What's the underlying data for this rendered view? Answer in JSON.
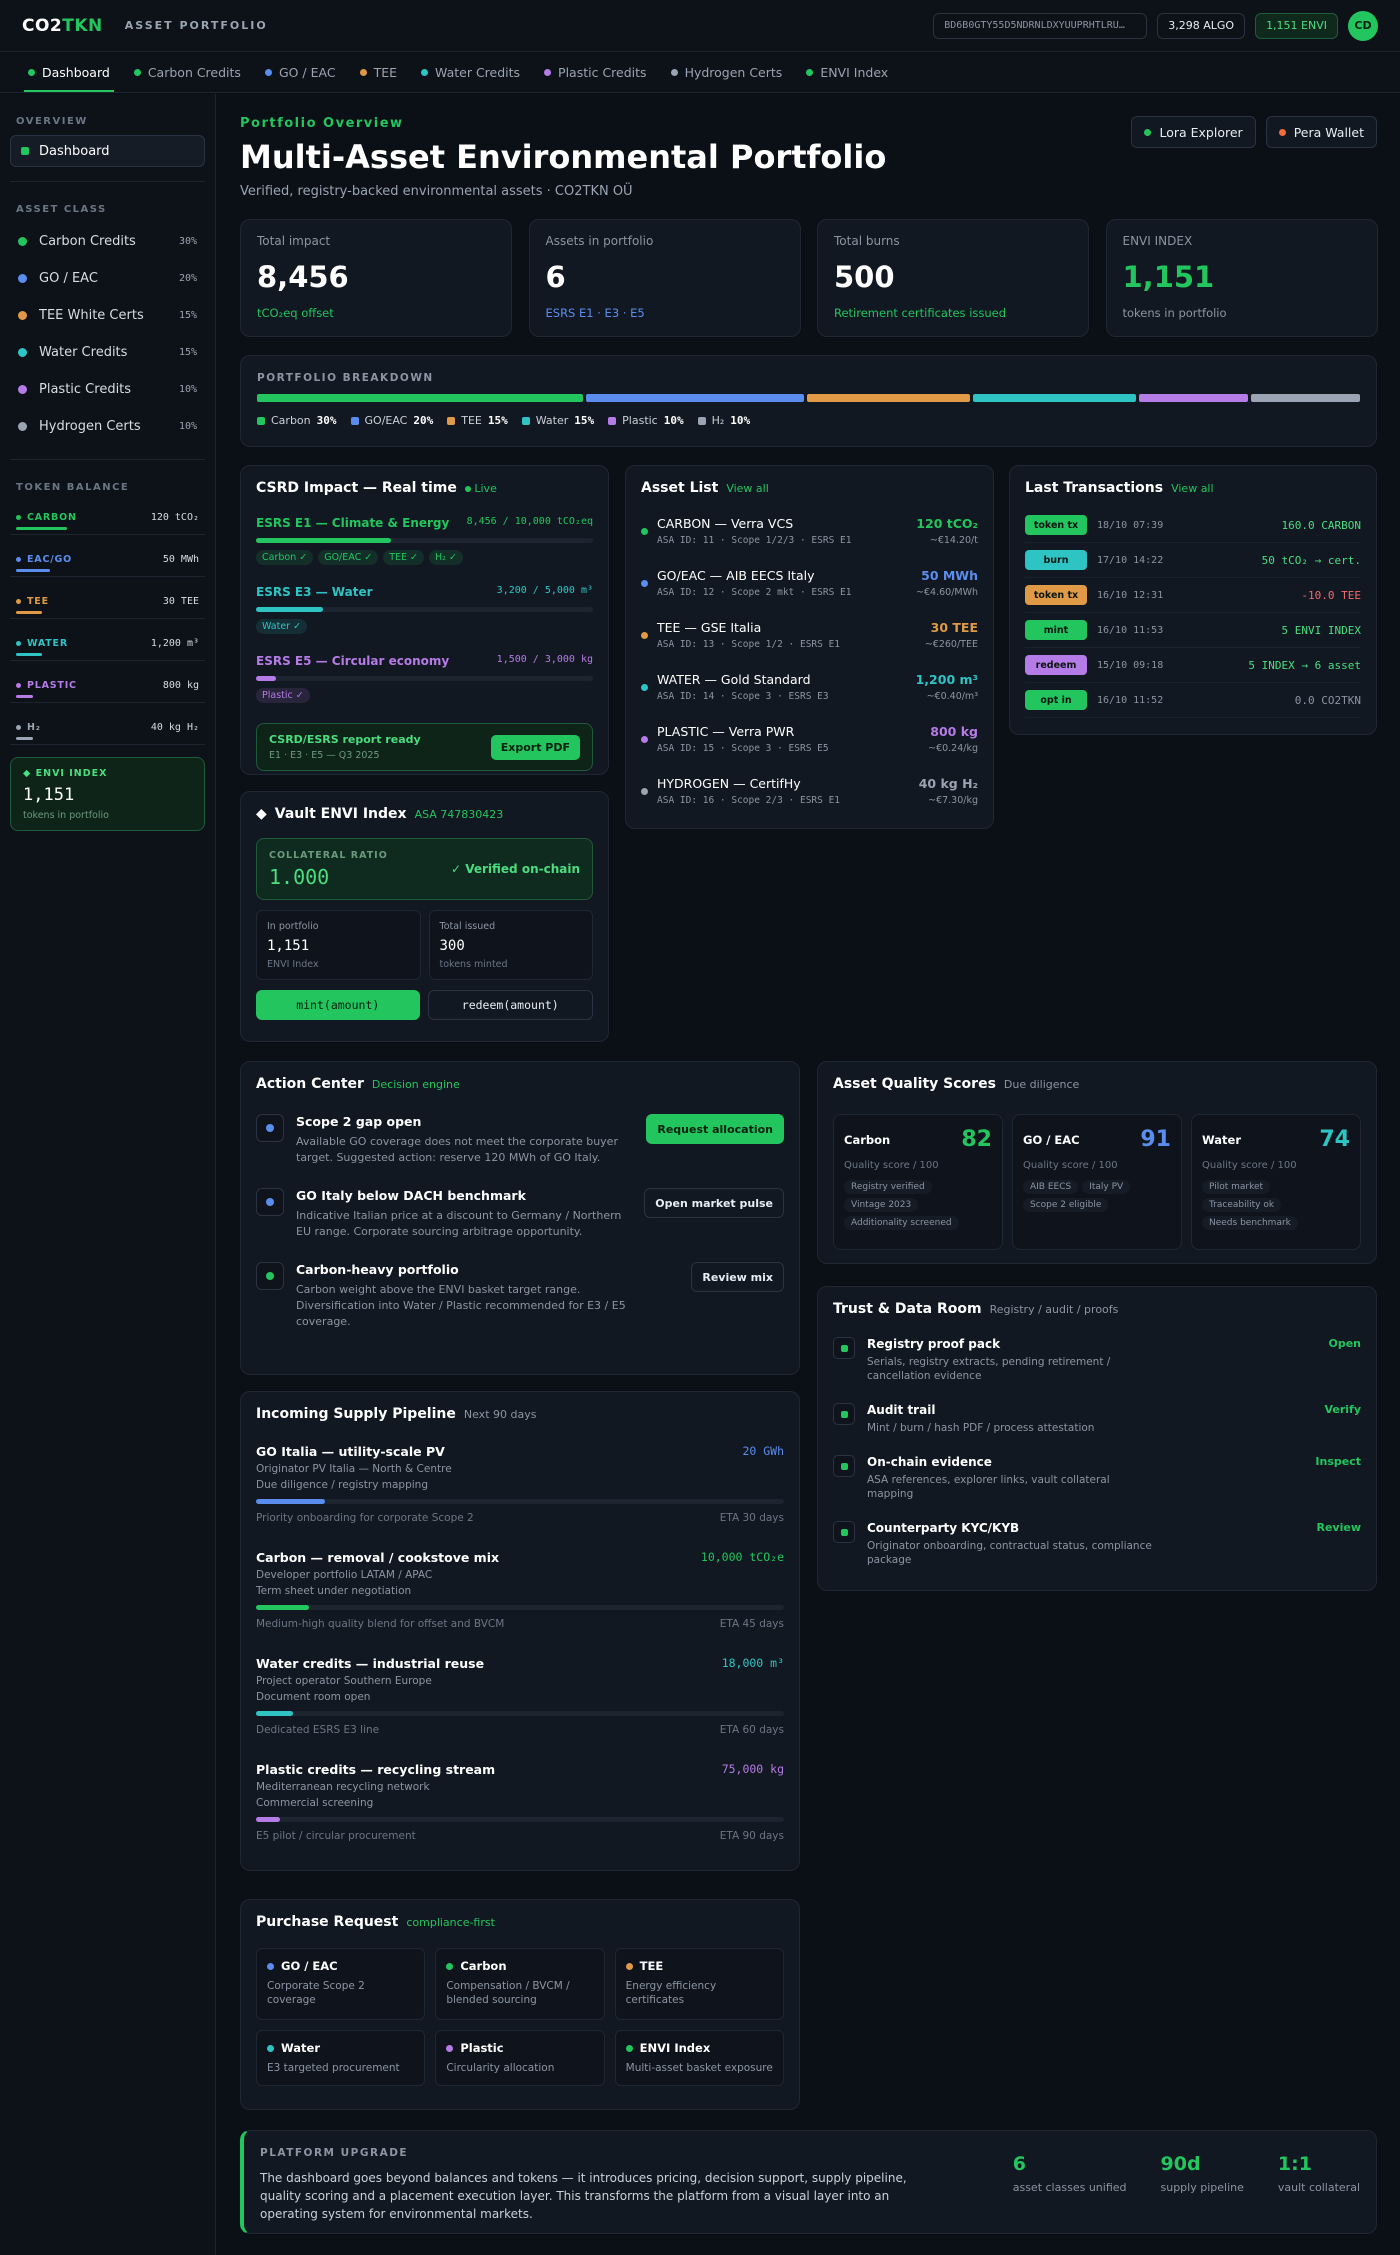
{
  "colors": {
    "carbon": "#22c55e",
    "go": "#5b8def",
    "tee": "#e09a45",
    "water": "#2ec4c4",
    "plastic": "#b57be6",
    "hydrogen": "#9aa4b2",
    "danger": "#f26b6b"
  },
  "topbar": {
    "brand_a": "CO2",
    "brand_b": "TKN",
    "subtitle": "ASSET PORTFOLIO",
    "address": "BD6B0GTY55D5NDRNLDXYUUPRHTLRU…",
    "algo": "3,298 ALGO",
    "envi": "1,151 ENVI",
    "avatar": "CD"
  },
  "tabs": [
    {
      "label": "Dashboard",
      "color": "#22c55e"
    },
    {
      "label": "Carbon Credits",
      "color": "#22c55e"
    },
    {
      "label": "GO / EAC",
      "color": "#5b8def"
    },
    {
      "label": "TEE",
      "color": "#e09a45"
    },
    {
      "label": "Water Credits",
      "color": "#2ec4c4"
    },
    {
      "label": "Plastic Credits",
      "color": "#b57be6"
    },
    {
      "label": "Hydrogen Certs",
      "color": "#9aa4b2"
    },
    {
      "label": "ENVI Index",
      "color": "#22c55e"
    }
  ],
  "sidebar": {
    "overview_heading": "OVERVIEW",
    "dashboard_label": "Dashboard",
    "asset_class_heading": "ASSET CLASS",
    "asset_classes": [
      {
        "label": "Carbon Credits",
        "pct": "30%",
        "color": "#22c55e"
      },
      {
        "label": "GO / EAC",
        "pct": "20%",
        "color": "#5b8def"
      },
      {
        "label": "TEE White Certs",
        "pct": "15%",
        "color": "#e09a45"
      },
      {
        "label": "Water Credits",
        "pct": "15%",
        "color": "#2ec4c4"
      },
      {
        "label": "Plastic Credits",
        "pct": "10%",
        "color": "#b57be6"
      },
      {
        "label": "Hydrogen Certs",
        "pct": "10%",
        "color": "#9aa4b2"
      }
    ],
    "token_heading": "TOKEN BALANCE",
    "tokens": [
      {
        "name": "CARBON",
        "value": "120 tCO₂",
        "color": "#22c55e",
        "fill": 0.3
      },
      {
        "name": "EAC/GO",
        "value": "50 MWh",
        "color": "#5b8def",
        "fill": 0.2
      },
      {
        "name": "TEE",
        "value": "30 TEE",
        "color": "#e09a45",
        "fill": 0.15
      },
      {
        "name": "WATER",
        "value": "1,200 m³",
        "color": "#2ec4c4",
        "fill": 0.15
      },
      {
        "name": "PLASTIC",
        "value": "800 kg",
        "color": "#b57be6",
        "fill": 0.1
      },
      {
        "name": "H₂",
        "value": "40 kg H₂",
        "color": "#9aa4b2",
        "fill": 0.1
      }
    ],
    "envi_label": "ENVI INDEX",
    "envi_value": "1,151",
    "envi_sub": "tokens in portfolio"
  },
  "header": {
    "eyebrow": "Portfolio Overview",
    "title": "Multi-Asset Environmental Portfolio",
    "subtitle": "Verified, registry-backed environmental assets · CO2TKN OÜ",
    "btn_lora": "Lora Explorer",
    "btn_pera": "Pera Wallet"
  },
  "kpis": [
    {
      "label": "Total impact",
      "value": "8,456",
      "sub": "tCO₂eq offset",
      "color": "#22c55e",
      "value_color": "#ffffff"
    },
    {
      "label": "Assets in portfolio",
      "value": "6",
      "sub": "ESRS E1 · E3 · E5",
      "color": "#5b8def",
      "value_color": "#ffffff"
    },
    {
      "label": "Total burns",
      "value": "500",
      "sub": "Retirement certificates issued",
      "color": "#22c55e",
      "value_color": "#ffffff"
    },
    {
      "label": "ENVI INDEX",
      "value": "1,151",
      "sub": "tokens in portfolio",
      "color": "#8b95a3",
      "value_color": "#22c55e"
    }
  ],
  "breakdown": {
    "label": "PORTFOLIO BREAKDOWN",
    "segments": [
      {
        "name": "Carbon",
        "pct": "30%",
        "share": 30,
        "color": "#22c55e"
      },
      {
        "name": "GO/EAC",
        "pct": "20%",
        "share": 20,
        "color": "#5b8def"
      },
      {
        "name": "TEE",
        "pct": "15%",
        "share": 15,
        "color": "#e09a45"
      },
      {
        "name": "Water",
        "pct": "15%",
        "share": 15,
        "color": "#2ec4c4"
      },
      {
        "name": "Plastic",
        "pct": "10%",
        "share": 10,
        "color": "#b57be6"
      },
      {
        "name": "H₂",
        "pct": "10%",
        "share": 10,
        "color": "#9aa4b2"
      }
    ]
  },
  "csrd": {
    "title": "CSRD Impact — Real time",
    "live": "Live",
    "rows": [
      {
        "label": "ESRS E1 — Climate & Energy",
        "value": "8,456 / 10,000 tCO₂eq",
        "fill": 0.4,
        "color": "#22c55e",
        "chips": [
          "Carbon ✓",
          "GO/EAC ✓",
          "TEE ✓",
          "H₂ ✓"
        ]
      },
      {
        "label": "ESRS E3 — Water",
        "value": "3,200 / 5,000 m³",
        "fill": 0.2,
        "color": "#2ec4c4",
        "chips": [
          "Water ✓"
        ]
      },
      {
        "label": "ESRS E5 — Circular economy",
        "value": "1,500 / 3,000 kg",
        "fill": 0.06,
        "color": "#b57be6",
        "chips": [
          "Plastic ✓"
        ]
      }
    ],
    "ready_title": "CSRD/ESRS report ready",
    "ready_sub": "E1 · E3 · E5 — Q3 2025",
    "export": "Export PDF"
  },
  "vault": {
    "title": "Vault ENVI Index",
    "asa": "ASA 747830423",
    "ratio_label": "COLLATERAL RATIO",
    "ratio_value": "1.000",
    "verified": "✓ Verified on-chain",
    "in_label": "In portfolio",
    "in_value": "1,151",
    "in_sub": "ENVI Index",
    "issued_label": "Total issued",
    "issued_value": "300",
    "issued_sub": "tokens minted",
    "mint": "mint(amount)",
    "redeem": "redeem(amount)"
  },
  "assets": {
    "title": "Asset List",
    "view_all": "View all",
    "items": [
      {
        "name": "CARBON — Verra VCS",
        "meta": "ASA ID: 11 · Scope 1/2/3 · ESRS E1",
        "value": "120 tCO₂",
        "price": "~€14.20/t",
        "color": "#22c55e"
      },
      {
        "name": "GO/EAC — AIB EECS Italy",
        "meta": "ASA ID: 12 · Scope 2 mkt · ESRS E1",
        "value": "50 MWh",
        "price": "~€4.60/MWh",
        "color": "#5b8def"
      },
      {
        "name": "TEE — GSE Italia",
        "meta": "ASA ID: 13 · Scope 1/2 · ESRS E1",
        "value": "30 TEE",
        "price": "~€260/TEE",
        "color": "#e09a45"
      },
      {
        "name": "WATER — Gold Standard",
        "meta": "ASA ID: 14 · Scope 3 · ESRS E3",
        "value": "1,200 m³",
        "price": "~€0.40/m³",
        "color": "#2ec4c4"
      },
      {
        "name": "PLASTIC — Verra PWR",
        "meta": "ASA ID: 15 · Scope 3 · ESRS E5",
        "value": "800 kg",
        "price": "~€0.24/kg",
        "color": "#b57be6"
      },
      {
        "name": "HYDROGEN — CertifHy",
        "meta": "ASA ID: 16 · Scope 2/3 · ESRS E1",
        "value": "40 kg H₂",
        "price": "~€7.30/kg",
        "color": "#9aa4b2"
      }
    ]
  },
  "transactions": {
    "title": "Last Transactions",
    "view_all": "View all",
    "items": [
      {
        "type": "token tx",
        "time": "18/10 07:39",
        "value": "160.0 CARBON",
        "badge": "#22c55e",
        "vcolor": "#4ade80"
      },
      {
        "type": "burn",
        "time": "17/10 14:22",
        "value": "50 tCO₂ → cert.",
        "badge": "#2ec4c4",
        "vcolor": "#4ade80"
      },
      {
        "type": "token tx",
        "time": "16/10 12:31",
        "value": "-10.0 TEE",
        "badge": "#e09a45",
        "vcolor": "#f26b6b"
      },
      {
        "type": "mint",
        "time": "16/10 11:53",
        "value": "5 ENVI INDEX",
        "badge": "#22c55e",
        "vcolor": "#4ade80"
      },
      {
        "type": "redeem",
        "time": "15/10 09:18",
        "value": "5 INDEX → 6 asset",
        "badge": "#b57be6",
        "vcolor": "#4ade80"
      },
      {
        "type": "opt in",
        "time": "16/10 11:52",
        "value": "0.0 CO2TKN",
        "badge": "#22c55e",
        "vcolor": "#8b95a3"
      }
    ]
  },
  "action_center": {
    "title": "Action Center",
    "tag": "Decision engine",
    "items": [
      {
        "title": "Scope 2 gap open",
        "desc": "Available GO coverage does not meet the corporate buyer target. Suggested action: reserve 120 MWh of GO Italy.",
        "button": "Request allocation",
        "primary": true,
        "color": "#5b8def"
      },
      {
        "title": "GO Italy below DACH benchmark",
        "desc": "Indicative Italian price at a discount to Germany / Northern EU range. Corporate sourcing arbitrage opportunity.",
        "button": "Open market pulse",
        "primary": false,
        "color": "#5b8def"
      },
      {
        "title": "Carbon-heavy portfolio",
        "desc": "Carbon weight above the ENVI basket target range. Diversification into Water / Plastic recommended for E3 / E5 coverage.",
        "button": "Review mix",
        "primary": false,
        "color": "#22c55e"
      }
    ]
  },
  "quality": {
    "title": "Asset Quality Scores",
    "tag": "Due diligence",
    "sub_label": "Quality score / 100",
    "items": [
      {
        "name": "Carbon",
        "score": "82",
        "color": "#22c55e",
        "chips": [
          "Registry verified",
          "Vintage 2023",
          "Additionality screened"
        ]
      },
      {
        "name": "GO / EAC",
        "score": "91",
        "color": "#5b8def",
        "chips": [
          "AIB EECS",
          "Italy PV",
          "Scope 2 eligible"
        ]
      },
      {
        "name": "Water",
        "score": "74",
        "color": "#2ec4c4",
        "chips": [
          "Pilot market",
          "Traceability ok",
          "Needs benchmark"
        ]
      }
    ]
  },
  "trust": {
    "title": "Trust & Data Room",
    "tag": "Registry / audit / proofs",
    "items": [
      {
        "title": "Registry proof pack",
        "desc": "Serials, registry extracts, pending retirement / cancellation evidence",
        "action": "Open"
      },
      {
        "title": "Audit trail",
        "desc": "Mint / burn / hash PDF / process attestation",
        "action": "Verify"
      },
      {
        "title": "On-chain evidence",
        "desc": "ASA references, explorer links, vault collateral mapping",
        "action": "Inspect"
      },
      {
        "title": "Counterparty KYC/KYB",
        "desc": "Originator onboarding, contractual status, compliance package",
        "action": "Review"
      }
    ]
  },
  "pipeline": {
    "title": "Incoming Supply Pipeline",
    "tag": "Next 90 days",
    "items": [
      {
        "name": "GO Italia — utility-scale PV",
        "value": "20 GWh",
        "color": "#5b8def",
        "line1": "Originator PV Italia — North & Centre",
        "line2": "Due diligence / registry mapping",
        "fill": 0.13,
        "note": "Priority onboarding for corporate Scope 2",
        "eta": "ETA 30 days"
      },
      {
        "name": "Carbon — removal / cookstove mix",
        "value": "10,000 tCO₂e",
        "color": "#22c55e",
        "line1": "Developer portfolio LATAM / APAC",
        "line2": "Term sheet under negotiation",
        "fill": 0.1,
        "note": "Medium-high quality blend for offset and BVCM",
        "eta": "ETA 45 days"
      },
      {
        "name": "Water credits — industrial reuse",
        "value": "18,000 m³",
        "color": "#2ec4c4",
        "line1": "Project operator Southern Europe",
        "line2": "Document room open",
        "fill": 0.07,
        "note": "Dedicated ESRS E3 line",
        "eta": "ETA 60 days"
      },
      {
        "name": "Plastic credits — recycling stream",
        "value": "75,000 kg",
        "color": "#b57be6",
        "line1": "Mediterranean recycling network",
        "line2": "Commercial screening",
        "fill": 0.045,
        "note": "E5 pilot / circular procurement",
        "eta": "ETA 90 days"
      }
    ]
  },
  "purchase": {
    "title": "Purchase Request",
    "tag": "compliance-first",
    "items": [
      {
        "name": "GO / EAC",
        "desc": "Corporate Scope 2 coverage",
        "color": "#5b8def"
      },
      {
        "name": "Carbon",
        "desc": "Compensation / BVCM / blended sourcing",
        "color": "#22c55e"
      },
      {
        "name": "TEE",
        "desc": "Energy efficiency certificates",
        "color": "#e09a45"
      },
      {
        "name": "Water",
        "desc": "E3 targeted procurement",
        "color": "#2ec4c4"
      },
      {
        "name": "Plastic",
        "desc": "Circularity allocation",
        "color": "#b57be6"
      },
      {
        "name": "ENVI Index",
        "desc": "Multi-asset basket exposure",
        "color": "#22c55e"
      }
    ]
  },
  "upgrade": {
    "label": "PLATFORM UPGRADE",
    "text": "The dashboard goes beyond balances and tokens — it introduces pricing, decision support, supply pipeline, quality scoring and a placement execution layer. This transforms the platform from a visual layer into an operating system for environmental markets.",
    "stats": [
      {
        "n": "6",
        "l": "asset classes unified"
      },
      {
        "n": "90d",
        "l": "supply pipeline"
      },
      {
        "n": "1:1",
        "l": "vault collateral"
      }
    ]
  }
}
